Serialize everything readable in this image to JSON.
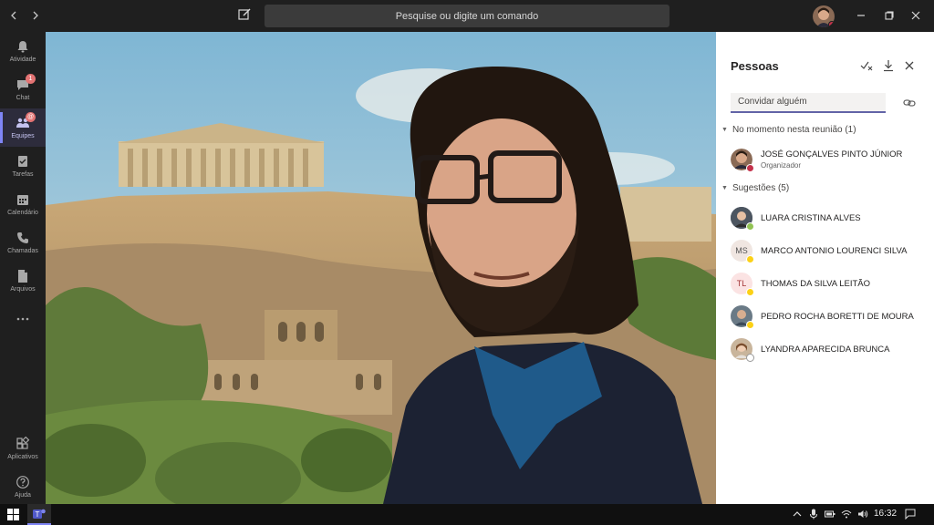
{
  "titlebar": {
    "search_placeholder": "Pesquise ou digite um comando"
  },
  "rail": [
    {
      "label": "Atividade",
      "icon": "bell-icon"
    },
    {
      "label": "Chat",
      "icon": "chat-icon",
      "badge": "1"
    },
    {
      "label": "Equipes",
      "icon": "teams-icon",
      "badge": "@",
      "active": true
    },
    {
      "label": "Tarefas",
      "icon": "tasks-icon"
    },
    {
      "label": "Calendário",
      "icon": "calendar-icon"
    },
    {
      "label": "Chamadas",
      "icon": "phone-icon"
    },
    {
      "label": "Arquivos",
      "icon": "files-icon"
    }
  ],
  "rail_bottom": [
    {
      "label": "Aplicativos",
      "icon": "apps-icon"
    },
    {
      "label": "Ajuda",
      "icon": "help-icon"
    }
  ],
  "panel": {
    "title": "Pessoas",
    "invite_placeholder": "Convidar alguém",
    "in_meeting_header": "No momento nesta reunião (1)",
    "participants": [
      {
        "name": "JOSÉ GONÇALVES PINTO JÚNIOR",
        "role": "Organizador",
        "status_color": "#c4314b"
      }
    ],
    "suggestions_header": "Sugestões (5)",
    "suggestions": [
      {
        "name": "LUARA CRISTINA ALVES",
        "initials": "",
        "status_color": "#92c353"
      },
      {
        "name": "MARCO ANTONIO LOURENCI SILVA",
        "initials": "MS",
        "status_color": "#fcd116"
      },
      {
        "name": "THOMAS DA SILVA LEITÃO",
        "initials": "TL",
        "status_color": "#fcd116"
      },
      {
        "name": "PEDRO ROCHA BORETTI DE MOURA",
        "initials": "",
        "status_color": "#fcd116"
      },
      {
        "name": "LYANDRA APARECIDA BRUNCA",
        "initials": "",
        "status_color": "#ffffff"
      }
    ]
  },
  "taskbar": {
    "time": "16:32"
  },
  "colors": {
    "accent": "#6264a7",
    "rail_active": "#7f85f5",
    "dark_bg": "#1f1f1f"
  }
}
